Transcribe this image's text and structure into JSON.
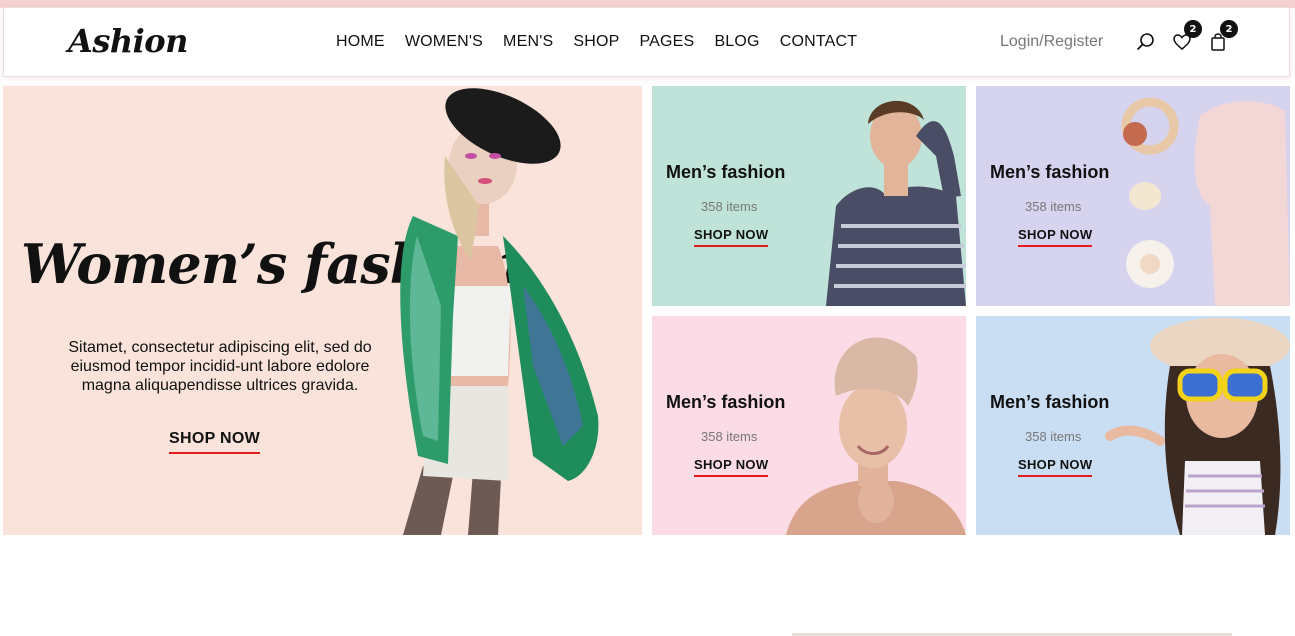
{
  "header": {
    "logo": "Ashion",
    "nav": [
      "HOME",
      "WOMEN'S",
      "MEN'S",
      "SHOP",
      "PAGES",
      "BLOG",
      "CONTACT"
    ],
    "login": "Login/Register",
    "wishlist_count": "2",
    "cart_count": "2",
    "icons": [
      "search-icon",
      "heart-icon",
      "bag-icon"
    ]
  },
  "hero": {
    "title": "Women’s fashion",
    "description": "Sitamet, consectetur adipiscing elit, sed do eiusmod tempor incidid-unt labore edolore magna aliquapendisse ultrices gravida.",
    "cta": "SHOP NOW",
    "background": "#f9e3da"
  },
  "cards": [
    {
      "title": "Men’s fashion",
      "count": "358 items",
      "cta": "SHOP NOW",
      "background": "#bfe3d8"
    },
    {
      "title": "Men’s fashion",
      "count": "358 items",
      "cta": "SHOP NOW",
      "background": "#d6d3ef"
    },
    {
      "title": "Men’s fashion",
      "count": "358 items",
      "cta": "SHOP NOW",
      "background": "#fbdbe5"
    },
    {
      "title": "Men’s fashion",
      "count": "358 items",
      "cta": "SHOP NOW",
      "background": "#c9def3"
    }
  ],
  "colors": {
    "accent": "#e31d1d",
    "text": "#111111",
    "muted": "#777777"
  }
}
